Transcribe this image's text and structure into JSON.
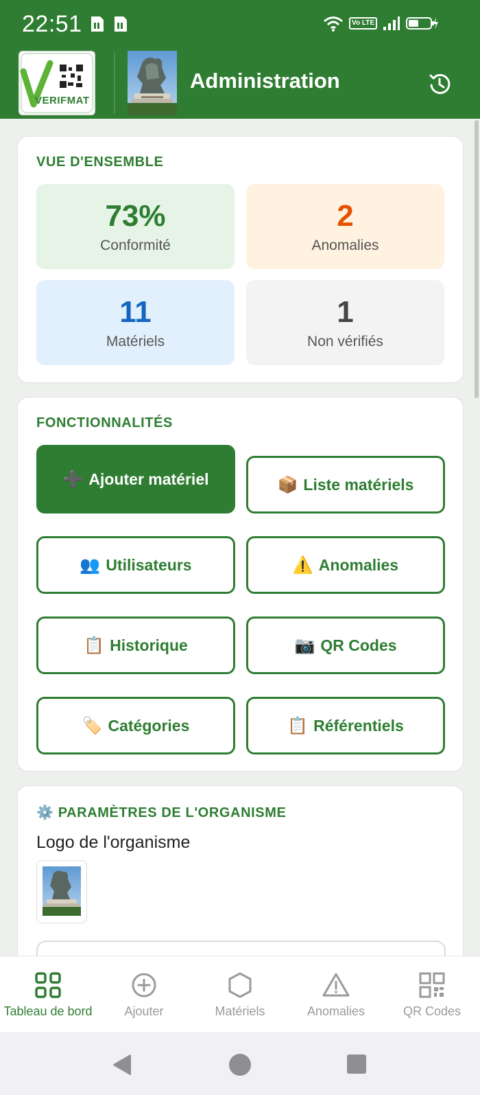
{
  "status_bar": {
    "time": "22:51",
    "volte_label": "Vo LTE"
  },
  "header": {
    "logo_text": "VERIFMAT",
    "title": "Administration",
    "history_icon": "history-icon"
  },
  "overview": {
    "title": "VUE D'ENSEMBLE",
    "stats": [
      {
        "value": "73%",
        "label": "Conformité",
        "color": "#2e7d32",
        "bg": "#e6f4e7"
      },
      {
        "value": "2",
        "label": "Anomalies",
        "color": "#e65100",
        "bg": "#fff2e0"
      },
      {
        "value": "11",
        "label": "Matériels",
        "color": "#1565c0",
        "bg": "#e2f0fd"
      },
      {
        "value": "1",
        "label": "Non vérifiés",
        "color": "#444444",
        "bg": "#f3f3f3"
      }
    ]
  },
  "features": {
    "title": "FONCTIONNALITÉS",
    "buttons": [
      {
        "emoji": "➕",
        "label": "Ajouter matériel"
      },
      {
        "emoji": "📦",
        "label": "Liste matériels"
      },
      {
        "emoji": "👥",
        "label": "Utilisateurs"
      },
      {
        "emoji": "⚠️",
        "label": "Anomalies"
      },
      {
        "emoji": "📋",
        "label": "Historique"
      },
      {
        "emoji": "📷",
        "label": "QR Codes"
      },
      {
        "emoji": "🏷️",
        "label": "Catégories"
      },
      {
        "emoji": "📋",
        "label": "Référentiels"
      }
    ]
  },
  "settings": {
    "emoji": "⚙️",
    "title": "PARAMÈTRES DE L'ORGANISME",
    "logo_label": "Logo de l'organisme"
  },
  "bottom_nav": [
    {
      "label": "Tableau de bord",
      "icon": "grid-icon",
      "active": true
    },
    {
      "label": "Ajouter",
      "icon": "plus-circle-icon",
      "active": false
    },
    {
      "label": "Matériels",
      "icon": "hexagon-icon",
      "active": false
    },
    {
      "label": "Anomalies",
      "icon": "warning-icon",
      "active": false
    },
    {
      "label": "QR Codes",
      "icon": "qr-code-icon",
      "active": false
    }
  ],
  "colors": {
    "brand": "#2e7d32",
    "background": "#eef0ee"
  }
}
